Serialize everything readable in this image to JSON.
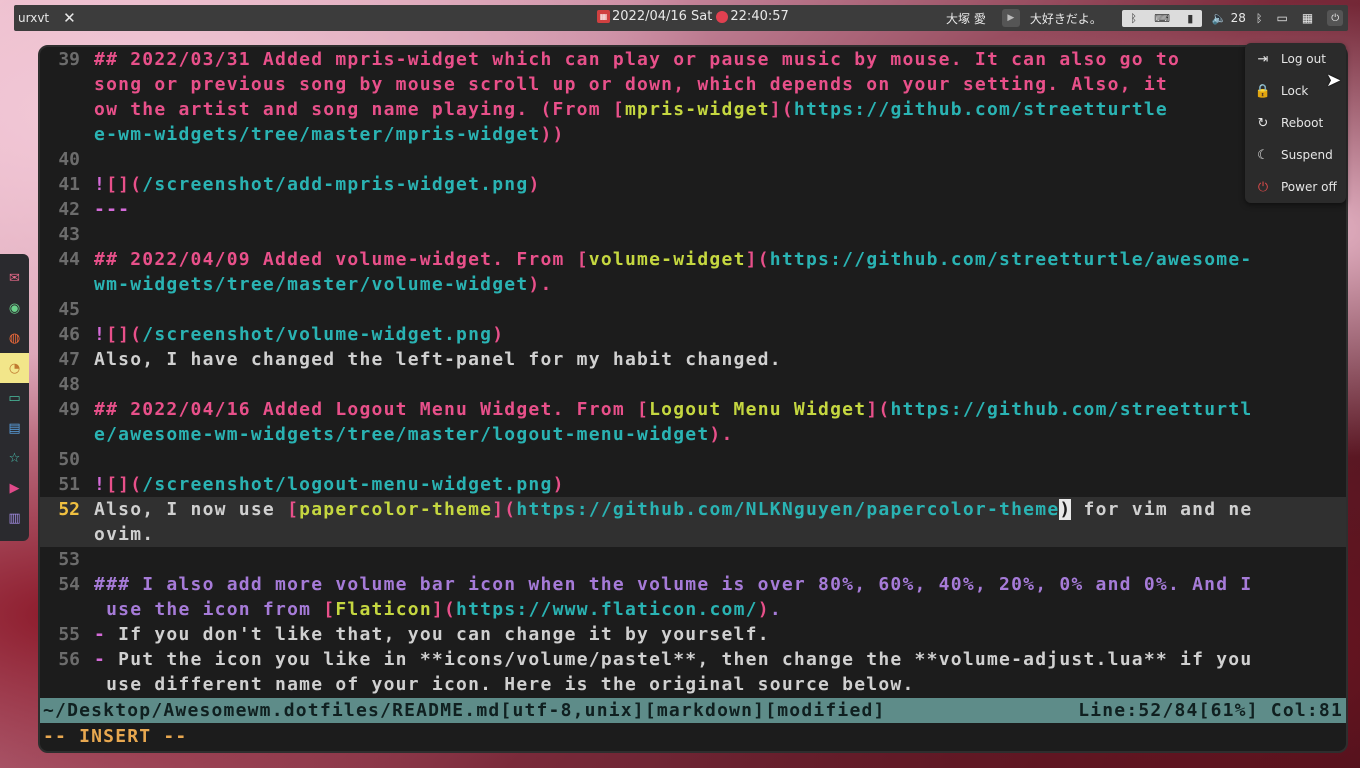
{
  "topbar": {
    "window_title": "urxvt",
    "close": "✕",
    "date": "2022/04/16 Sat",
    "time": "22:40:57",
    "artist": "大塚 愛",
    "song": "大好きだよ。",
    "volume": "28"
  },
  "dock": {
    "items": [
      "mail-icon",
      "spotify-icon",
      "firefox-icon",
      "clock-icon",
      "folder-icon",
      "notes-icon",
      "star-icon",
      "youtube-icon",
      "file-icon"
    ]
  },
  "editor": {
    "lines": [
      {
        "n": "39",
        "segs": [
          [
            "h",
            "## 2022/03/31 Added mpris-widget which can play or pause music by mouse. It can also go to"
          ]
        ]
      },
      {
        "n": "",
        "segs": [
          [
            "h",
            "song or previous song by mouse scroll up or down, which depends on your setting. Also, it"
          ]
        ]
      },
      {
        "n": "",
        "segs": [
          [
            "h",
            "ow the artist and song name playing. (From "
          ],
          [
            "br",
            "["
          ],
          [
            "lnk",
            "mpris-widget"
          ],
          [
            "br",
            "]("
          ],
          [
            "url",
            "https://github.com/streetturtle"
          ]
        ]
      },
      {
        "n": "",
        "segs": [
          [
            "url",
            "e-wm-widgets/tree/master/mpris-widget"
          ],
          [
            "br",
            "))"
          ]
        ]
      },
      {
        "n": "40",
        "segs": []
      },
      {
        "n": "41",
        "segs": [
          [
            "img",
            "!"
          ],
          [
            "br",
            "[]("
          ],
          [
            "pth",
            "/screenshot/add-mpris-widget.png"
          ],
          [
            "br",
            ")"
          ]
        ]
      },
      {
        "n": "42",
        "segs": [
          [
            "hr",
            "---"
          ]
        ]
      },
      {
        "n": "43",
        "segs": []
      },
      {
        "n": "44",
        "segs": [
          [
            "h",
            "## 2022/04/09 Added volume-widget. From "
          ],
          [
            "br",
            "["
          ],
          [
            "lnk",
            "volume-widget"
          ],
          [
            "br",
            "]("
          ],
          [
            "url",
            "https://github.com/streetturtle/awesome-"
          ]
        ]
      },
      {
        "n": "",
        "segs": [
          [
            "url",
            "wm-widgets/tree/master/volume-widget"
          ],
          [
            "br",
            ")"
          ],
          [
            "h",
            "."
          ]
        ]
      },
      {
        "n": "45",
        "segs": []
      },
      {
        "n": "46",
        "segs": [
          [
            "img",
            "!"
          ],
          [
            "br",
            "[]("
          ],
          [
            "pth",
            "/screenshot/volume-widget.png"
          ],
          [
            "br",
            ")"
          ]
        ]
      },
      {
        "n": "47",
        "segs": [
          [
            "t",
            "Also, I have changed the left-panel for my habit changed."
          ]
        ]
      },
      {
        "n": "48",
        "segs": []
      },
      {
        "n": "49",
        "segs": [
          [
            "h",
            "## 2022/04/16 Added Logout Menu Widget. From "
          ],
          [
            "br",
            "["
          ],
          [
            "lnk",
            "Logout Menu Widget"
          ],
          [
            "br",
            "]("
          ],
          [
            "url",
            "https://github.com/streetturtl"
          ]
        ]
      },
      {
        "n": "",
        "segs": [
          [
            "url",
            "e/awesome-wm-widgets/tree/master/logout-menu-widget"
          ],
          [
            "br",
            ")"
          ],
          [
            "h",
            "."
          ]
        ]
      },
      {
        "n": "50",
        "segs": []
      },
      {
        "n": "51",
        "segs": [
          [
            "img",
            "!"
          ],
          [
            "br",
            "[]("
          ],
          [
            "pth",
            "/screenshot/logout-menu-widget.png"
          ],
          [
            "br",
            ")"
          ]
        ]
      },
      {
        "n": "52",
        "cur": true,
        "segs": [
          [
            "t",
            "Also, I now use "
          ],
          [
            "br",
            "["
          ],
          [
            "lnk",
            "papercolor-theme"
          ],
          [
            "br",
            "]("
          ],
          [
            "url",
            "https://github.com/NLKNguyen/papercolor-theme"
          ],
          [
            "cursor",
            ")"
          ],
          [
            "t",
            " for vim and ne"
          ]
        ]
      },
      {
        "n": "",
        "cur": true,
        "segs": [
          [
            "t",
            "ovim."
          ]
        ]
      },
      {
        "n": "53",
        "segs": []
      },
      {
        "n": "54",
        "segs": [
          [
            "h3",
            "### I also add more volume bar icon when the volume is over 80%, 60%, 40%, 20%, 0% and 0%. And I"
          ]
        ]
      },
      {
        "n": "",
        "segs": [
          [
            "h3",
            " use the icon from "
          ],
          [
            "br",
            "["
          ],
          [
            "lnk",
            "Flaticon"
          ],
          [
            "br",
            "]("
          ],
          [
            "url",
            "https://www.flaticon.com/"
          ],
          [
            "br",
            ")"
          ],
          [
            "h3",
            "."
          ]
        ]
      },
      {
        "n": "55",
        "segs": [
          [
            "li",
            "-"
          ],
          [
            "t",
            " If you don't like that, you can change it by yourself."
          ]
        ]
      },
      {
        "n": "56",
        "segs": [
          [
            "li",
            "-"
          ],
          [
            "t",
            " Put the icon you like in **icons/volume/pastel**, then change the **volume-adjust.lua** if you"
          ]
        ]
      },
      {
        "n": "",
        "segs": [
          [
            "t",
            " use different name of your icon. Here is the original source below."
          ]
        ]
      }
    ],
    "status_left": "~/Desktop/Awesomewm.dotfiles/README.md[utf-8,unix][markdown][modified]",
    "status_right": "Line:52/84[61%] Col:81",
    "mode": "-- INSERT --"
  },
  "logout_menu": {
    "items": [
      {
        "label": "Log out",
        "icon": "⇥"
      },
      {
        "label": "Lock",
        "icon": "🔒"
      },
      {
        "label": "Reboot",
        "icon": "↻"
      },
      {
        "label": "Suspend",
        "icon": "☾"
      },
      {
        "label": "Power off",
        "icon": "⏻"
      }
    ]
  }
}
